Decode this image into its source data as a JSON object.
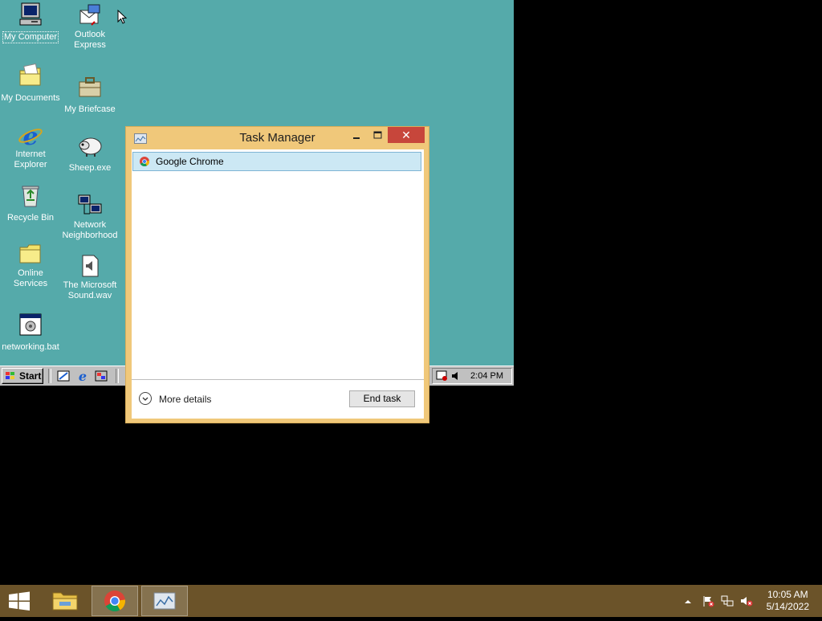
{
  "guest": {
    "desktop_icons": [
      {
        "label": "My Computer",
        "icon": "my-computer-icon"
      },
      {
        "label": "Outlook\nExpress",
        "icon": "outlook-express-icon"
      },
      {
        "label": "My Documents",
        "icon": "folder-documents-icon"
      },
      {
        "label": "My Briefcase",
        "icon": "briefcase-icon"
      },
      {
        "label": "Internet\nExplorer",
        "icon": "internet-explorer-icon"
      },
      {
        "label": "Sheep.exe",
        "icon": "sheep-icon"
      },
      {
        "label": "Recycle Bin",
        "icon": "recycle-bin-icon"
      },
      {
        "label": "Network\nNeighborhood",
        "icon": "network-icon"
      },
      {
        "label": "Online\nServices",
        "icon": "folder-icon"
      },
      {
        "label": "The Microsoft\nSound.wav",
        "icon": "sound-file-icon"
      },
      {
        "label": "networking.bat",
        "icon": "batch-file-icon"
      }
    ],
    "taskbar": {
      "start_label": "Start",
      "clock": "2:04 PM",
      "quick_launch": [
        "show-desktop-icon",
        "internet-explorer-icon",
        "channels-icon"
      ]
    }
  },
  "task_manager": {
    "title": "Task Manager",
    "processes": [
      {
        "name": "Google Chrome"
      }
    ],
    "more_details_label": "More details",
    "end_task_label": "End task"
  },
  "host_taskbar": {
    "clock_time": "10:05 AM",
    "clock_date": "5/14/2022",
    "pinned": [
      "file-explorer-icon",
      "chrome-icon",
      "task-manager-icon"
    ],
    "tray": [
      "show-hidden-icons-icon",
      "action-center-flag-icon",
      "network-icon",
      "volume-muted-icon"
    ]
  },
  "colors": {
    "desktop98": "#55aaaa",
    "window_frame": "#f0c87a",
    "close_button": "#c7463b",
    "selection": "#cce8f4",
    "host_taskbar": "#6b5329"
  }
}
